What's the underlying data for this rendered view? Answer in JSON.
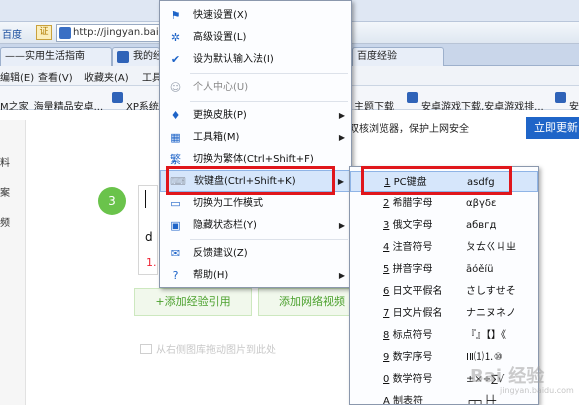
{
  "browser": {
    "brand": "百度",
    "cert_badge": "证",
    "url": "http://jingyan.bai",
    "tabs": [
      "——实用生活指南",
      "我的经",
      "百度经验"
    ],
    "menus": [
      "编辑(E)",
      "查看(V)",
      "收藏夹(A)",
      "工具"
    ],
    "favorites": [
      "M之家_海量精品安卓...",
      "XP系统",
      "主题下载",
      "安卓游戏下载,安卓游戏排...",
      "安"
    ]
  },
  "page": {
    "left_strip": [
      "料",
      "案",
      "频"
    ],
    "notice": "双核浏览器，保护上网安全",
    "update_button": "立即更新",
    "step_number": "3",
    "editor_text": "d",
    "editor_number": "1.",
    "btn_add_ref": "+添加经验引用",
    "btn_add_net": "添加网络视频",
    "hint": "从右侧图库拖动图片到此处"
  },
  "context_menu": {
    "items": [
      {
        "label": "快速设置(X)",
        "icon": "flag-icon",
        "disabled": false,
        "submenu": false
      },
      {
        "label": "高级设置(L)",
        "icon": "gear-icon",
        "disabled": false,
        "submenu": false
      },
      {
        "label": "设为默认输入法(I)",
        "icon": "check-circle-icon",
        "disabled": false,
        "submenu": false
      },
      {
        "label": "个人中心(U)",
        "icon": "user-icon",
        "disabled": true,
        "submenu": false
      },
      {
        "label": "更换皮肤(P)",
        "icon": "shirt-icon",
        "disabled": false,
        "submenu": true
      },
      {
        "label": "工具箱(M)",
        "icon": "grid-icon",
        "disabled": false,
        "submenu": true
      },
      {
        "label": "切换为繁体(Ctrl+Shift+F)",
        "icon": "traditional-char-icon",
        "disabled": false,
        "submenu": false
      },
      {
        "label": "软键盘(Ctrl+Shift+K)",
        "icon": "keyboard-icon",
        "disabled": false,
        "submenu": true
      },
      {
        "label": "切换为工作模式",
        "icon": "work-mode-icon",
        "disabled": false,
        "submenu": false
      },
      {
        "label": "隐藏状态栏(Y)",
        "icon": "hide-statusbar-icon",
        "disabled": false,
        "submenu": true
      },
      {
        "label": "反馈建议(Z)",
        "icon": "feedback-icon",
        "disabled": false,
        "submenu": false
      },
      {
        "label": "帮助(H)",
        "icon": "help-icon",
        "disabled": false,
        "submenu": true
      }
    ]
  },
  "softkeyboard_menu": {
    "items": [
      {
        "key": "1",
        "label": "PC键盘",
        "sample": "asdfg"
      },
      {
        "key": "2",
        "label": "希腊字母",
        "sample": "αβγδε"
      },
      {
        "key": "3",
        "label": "俄文字母",
        "sample": "абвгд"
      },
      {
        "key": "4",
        "label": "注音符号",
        "sample": "ㄆㄊㄍㄐㄓ"
      },
      {
        "key": "5",
        "label": "拼音字母",
        "sample": "āóěíü"
      },
      {
        "key": "6",
        "label": "日文平假名",
        "sample": "さしすせそ"
      },
      {
        "key": "7",
        "label": "日文片假名",
        "sample": "ナニヌネノ"
      },
      {
        "key": "8",
        "label": "标点符号",
        "sample": "『』【】《"
      },
      {
        "key": "9",
        "label": "数字序号",
        "sample": "ⅠⅡ⑴⒈⑩"
      },
      {
        "key": "0",
        "label": "数学符号",
        "sample": "±×÷∑√"
      },
      {
        "key": "A",
        "label": "制表符",
        "sample": "┌┬┐├┼"
      }
    ]
  },
  "watermark": {
    "text": "Bai 经验",
    "sub": "jingyan.baidu.com"
  },
  "colors": {
    "highlight": "#e0161b",
    "menu_hover": "#d6e6fb",
    "update_button": "#1f65c8",
    "step_circle": "#6ac34b"
  }
}
